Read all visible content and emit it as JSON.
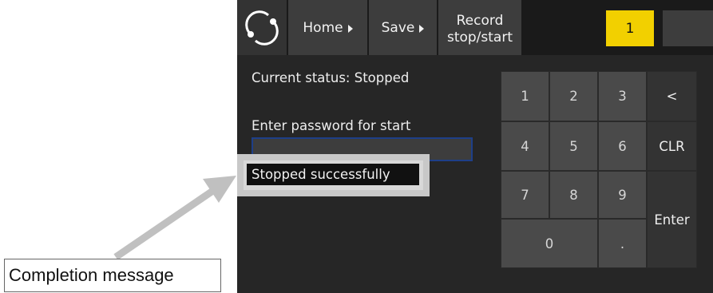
{
  "toolbar": {
    "home_label": "Home",
    "save_label": "Save",
    "record_line1": "Record",
    "record_line2": "stop/start",
    "indicator_value": "1",
    "indicator_color": "#f2d000"
  },
  "status": {
    "text": "Current status: Stopped"
  },
  "password": {
    "label": "Enter password for start",
    "value": ""
  },
  "message": {
    "text": "Stopped successfully"
  },
  "keypad": {
    "k1": "1",
    "k2": "2",
    "k3": "3",
    "back": "<",
    "k4": "4",
    "k5": "5",
    "k6": "6",
    "clr": "CLR",
    "k7": "7",
    "k8": "8",
    "k9": "9",
    "enter": "Enter",
    "k0": "0",
    "dot": "."
  },
  "annotation": {
    "callout_text": "Completion message"
  },
  "icons": [
    "app-logo-icon",
    "caret-right-icon"
  ]
}
